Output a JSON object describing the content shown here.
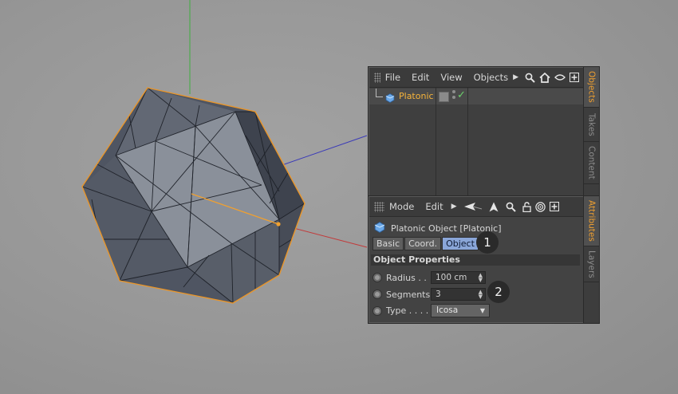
{
  "objects_panel": {
    "menu": [
      "File",
      "Edit",
      "View",
      "Objects"
    ],
    "side_tabs": [
      "Objects",
      "Takes",
      "Content"
    ],
    "items": [
      {
        "name": "Platonic"
      }
    ]
  },
  "attributes_panel": {
    "menu": [
      "Mode",
      "Edit"
    ],
    "side_tabs": [
      "Attributes",
      "Layers"
    ],
    "title": "Platonic Object [Platonic]",
    "tabs": [
      "Basic",
      "Coord.",
      "Object"
    ],
    "active_tab": "Object",
    "section": "Object Properties",
    "properties": [
      {
        "label": "Radius . .",
        "value": "100 cm",
        "control": "spinner"
      },
      {
        "label": "Segments",
        "value": "3",
        "control": "spinner"
      },
      {
        "label": "Type . . . .",
        "value": "Icosa",
        "control": "dropdown"
      }
    ]
  },
  "callouts": [
    "1",
    "2"
  ],
  "colors": {
    "accent_orange": "#f7b43a",
    "active_tab_blue": "#8aa6d8",
    "axis_green": "#3fae3f",
    "axis_blue": "#3a3ab8",
    "axis_red": "#c23a3a",
    "selection_outline": "#e8952a",
    "checkmark": "#6cd36c"
  },
  "icons": [
    "grip-icon",
    "search-icon",
    "home-icon",
    "eye-icon",
    "new-panel-icon",
    "back-arrow-icon",
    "up-arrow-icon",
    "lock-icon",
    "target-icon",
    "platonic-object-icon",
    "layer-square-icon",
    "check-icon"
  ]
}
